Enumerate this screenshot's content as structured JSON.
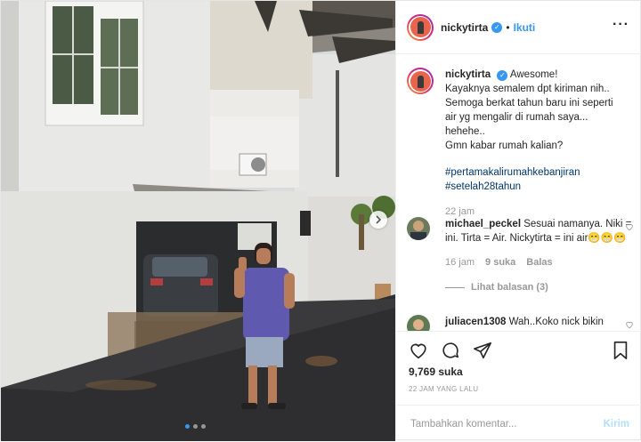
{
  "post": {
    "username": "nickytirta",
    "verified": true,
    "follow_label": "Ikuti",
    "more_icon": "ellipsis-icon",
    "carousel": {
      "slides": 3,
      "active_index": 0
    }
  },
  "caption": {
    "username": "nickytirta",
    "lines": [
      "Awesome!",
      "Kayaknya semalem dpt kiriman nih..",
      "Semoga berkat tahun baru ini seperti",
      "air yg mengalir di rumah saya...",
      "hehehe..",
      "Gmn kabar rumah kalian?"
    ],
    "hashtags": [
      "#pertamakalirumahkebanjiran",
      "#setelah28tahun"
    ],
    "time": "22 jam"
  },
  "comments": [
    {
      "username": "michael_peckel",
      "text": "Sesuai namanya. Niki = ini. Tirta = Air. Nickytirta = ini air😁😁😁",
      "time": "16 jam",
      "likes": "9 suka",
      "reply_label": "Balas",
      "view_replies": "Lihat balasan (3)"
    },
    {
      "username": "juliacen1308",
      "text": "Wah..Koko nick bikin"
    }
  ],
  "actions": {
    "likes": "9,769 suka",
    "timestamp": "22 JAM YANG LALU",
    "comment_placeholder": "Tambahkan komentar...",
    "send_label": "Kirim"
  },
  "colors": {
    "accent": "#3897f0",
    "hashtag": "#003569",
    "muted": "#999999"
  }
}
